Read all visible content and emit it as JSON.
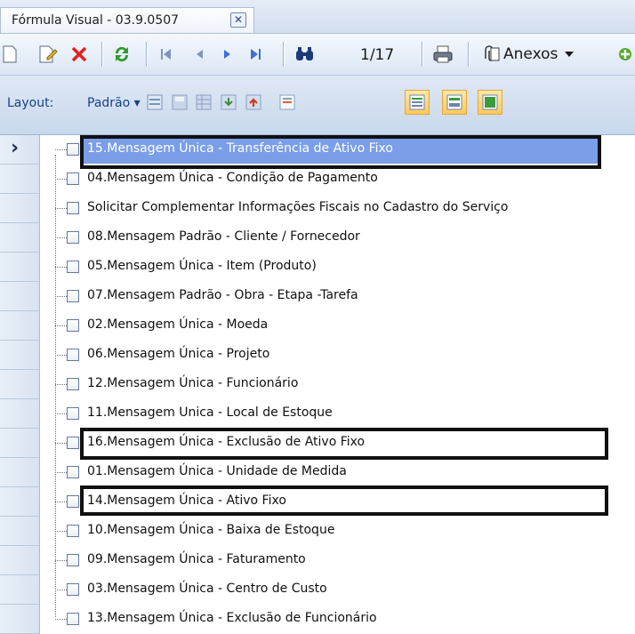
{
  "tab": {
    "title": "Fórmula Visual - 03.9.0507",
    "close_icon": "close-icon"
  },
  "toolbar": {
    "icons": [
      "new-document-icon",
      "edit-document-icon",
      "delete-icon",
      "refresh-icon",
      "first-record-icon",
      "previous-record-icon",
      "next-record-icon",
      "last-record-icon",
      "find-icon",
      "print-icon",
      "paperclip-icon",
      "dropdown-arrow-icon",
      "add-icon"
    ],
    "pager": "1/17",
    "attachments_label": "Anexos"
  },
  "layout": {
    "label": "Layout:",
    "value": "Padrão"
  },
  "rows": [
    {
      "label": "15.Mensagem Única - Transferência de Ativo Fixo",
      "selected": true
    },
    {
      "label": "04.Mensagem Única - Condição de Pagamento"
    },
    {
      "label": "Solicitar Complementar Informações Fiscais no Cadastro do Serviço"
    },
    {
      "label": "08.Mensagem Padrão - Cliente / Fornecedor"
    },
    {
      "label": "05.Mensagem Única - Item (Produto)"
    },
    {
      "label": "07.Mensagem Padrão -  Obra - Etapa -Tarefa"
    },
    {
      "label": "02.Mensagem Única - Moeda"
    },
    {
      "label": "06.Mensagem Única - Projeto"
    },
    {
      "label": "12.Mensagem Única - Funcionário"
    },
    {
      "label": "11.Mensagem Unica - Local de Estoque"
    },
    {
      "label": "16.Mensagem Única - Exclusão de Ativo Fixo"
    },
    {
      "label": "01.Mensagem Única - Unidade de Medida"
    },
    {
      "label": "14.Mensagem Única - Ativo Fixo"
    },
    {
      "label": "10.Mensagem Única - Baixa de Estoque"
    },
    {
      "label": "09.Mensagem Única - Faturamento"
    },
    {
      "label": "03.Mensagem Única - Centro de Custo"
    },
    {
      "label": "13.Mensagem Única - Exclusão de Funcionário"
    }
  ],
  "colors": {
    "selection": "#7a9ee8",
    "callout_border": "#111111",
    "accent": "#15428b"
  }
}
